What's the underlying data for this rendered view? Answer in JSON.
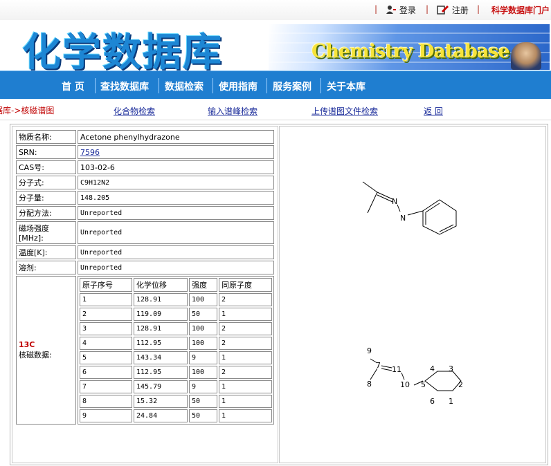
{
  "topbar": {
    "login": "登录",
    "register": "注册",
    "portal": "科学数据库门户",
    "separator": "|"
  },
  "banner": {
    "logo_text": "化学数据库",
    "english_title": "Chemistry Database"
  },
  "nav": {
    "items": [
      "首 页",
      "查找数据库",
      "数据检索",
      "使用指南",
      "服务案例",
      "关于本库"
    ]
  },
  "subnav": {
    "breadcrumb": "据库->核磁谱图",
    "links": [
      "化合物检索",
      "输入谱峰检索",
      "上传谱图文件检索",
      "返 回"
    ]
  },
  "compound": {
    "rows": [
      {
        "label": "物质名称:",
        "value": "Acetone phenylhydrazone"
      },
      {
        "label": "SRN:",
        "value": "7596"
      },
      {
        "label": "CAS号:",
        "value": "103-02-6"
      },
      {
        "label": "分子式:",
        "value": "C9H12N2"
      },
      {
        "label": "分子量:",
        "value": "148.205"
      },
      {
        "label": "分配方法:",
        "value": "Unreported"
      },
      {
        "label": "磁场强度[MHz]:",
        "value": "Unreported"
      },
      {
        "label": "温度[K]:",
        "value": "Unreported"
      },
      {
        "label": "溶剂:",
        "value": "Unreported"
      }
    ],
    "nmr_label_prefix": "13C",
    "nmr_label": "核磁数据:"
  },
  "nmr": {
    "headers": [
      "原子序号",
      "化学位移",
      "强度",
      "同原子度"
    ],
    "rows": [
      [
        "1",
        "128.91",
        "100",
        "2"
      ],
      [
        "2",
        "119.09",
        "50",
        "1"
      ],
      [
        "3",
        "128.91",
        "100",
        "2"
      ],
      [
        "4",
        "112.95",
        "100",
        "2"
      ],
      [
        "5",
        "143.34",
        "9",
        "1"
      ],
      [
        "6",
        "112.95",
        "100",
        "2"
      ],
      [
        "7",
        "145.79",
        "9",
        "1"
      ],
      [
        "8",
        "15.32",
        "50",
        "1"
      ],
      [
        "9",
        "24.84",
        "50",
        "1"
      ]
    ]
  },
  "structure": {
    "atom_N": "N",
    "numbered_labels": [
      "9",
      "7",
      "11",
      "8",
      "10",
      "4",
      "3",
      "5",
      "2",
      "6",
      "1"
    ]
  },
  "colors": {
    "nav_blue": "#1f7ed0",
    "link_blue": "#1a2b9a",
    "red": "#c00000"
  }
}
